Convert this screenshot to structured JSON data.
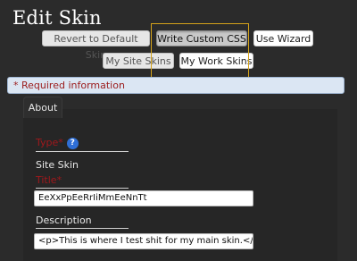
{
  "page": {
    "title": "Edit Skin"
  },
  "toolbar": {
    "revert_label": "Revert to Default Skin",
    "write_css_label": "Write Custom CSS",
    "wizard_label": "Use Wizard",
    "site_skins_label": "My Site Skins",
    "work_skins_label": "My Work Skins"
  },
  "notice": {
    "required_text": "* Required information"
  },
  "tabs": [
    {
      "label": "About"
    }
  ],
  "form": {
    "type": {
      "label": "Type*",
      "help_glyph": "?",
      "value": "Site Skin"
    },
    "title": {
      "label": "Title*",
      "value": "EeXxPpEeRrIiMmEeNnTt"
    },
    "description": {
      "label": "Description",
      "value": "<p>This is where I test shit for my main skin.</"
    }
  },
  "colors": {
    "background": "#2b2b2b",
    "required": "#a0181c",
    "notice_bg": "#dbe6f3",
    "highlight": "#d4a21a",
    "help_icon": "#2f6fd6"
  }
}
